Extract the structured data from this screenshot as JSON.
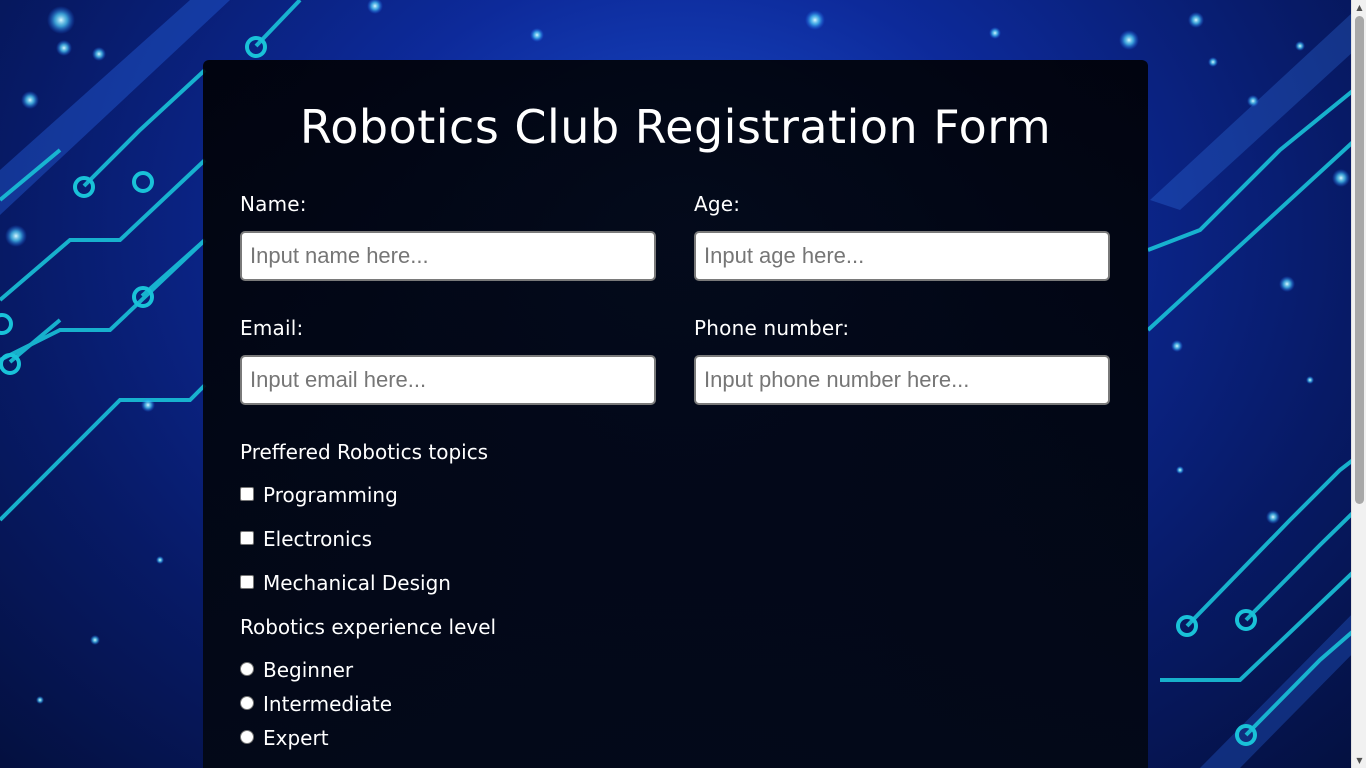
{
  "form": {
    "title": "Robotics Club Registration Form",
    "fields": {
      "name": {
        "label": "Name:",
        "placeholder": "Input name here...",
        "value": ""
      },
      "age": {
        "label": "Age:",
        "placeholder": "Input age here...",
        "value": ""
      },
      "email": {
        "label": "Email:",
        "placeholder": "Input email here...",
        "value": ""
      },
      "phone": {
        "label": "Phone number:",
        "placeholder": "Input phone number here...",
        "value": ""
      }
    },
    "topics": {
      "label": "Preffered Robotics topics",
      "options": [
        "Programming",
        "Electronics",
        "Mechanical Design"
      ]
    },
    "experience": {
      "label": "Robotics experience level",
      "options": [
        "Beginner",
        "Intermediate",
        "Expert"
      ]
    }
  },
  "colors": {
    "background": "#0d2a9a",
    "panel": "#000000",
    "circuit": "#19c2d8",
    "text": "#ffffff"
  }
}
